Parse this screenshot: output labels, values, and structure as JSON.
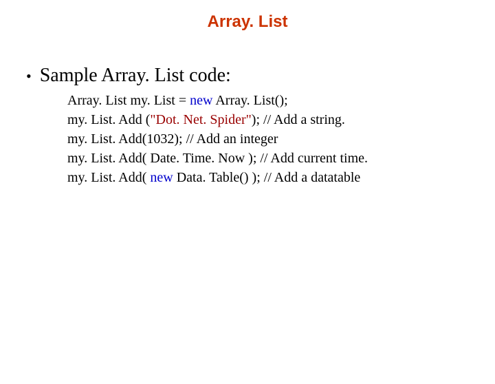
{
  "title": "Array. List",
  "bullet_text": "Sample Array. List code:",
  "code": {
    "line1": {
      "p1": "Array. List my. List = ",
      "kw1": "new",
      "p2": " Array. List();"
    },
    "line2": {
      "p1": "my. List. Add (",
      "str": "\"Dot. Net. Spider\"",
      "p2": "); // Add a string."
    },
    "line3": "my. List. Add(1032); // Add an integer",
    "line4": "my. List. Add( Date. Time. Now ); // Add current time.",
    "line5": {
      "p1": "my. List. Add( ",
      "kw1": "new",
      "p2": " Data. Table() ); // Add a datatable"
    }
  }
}
